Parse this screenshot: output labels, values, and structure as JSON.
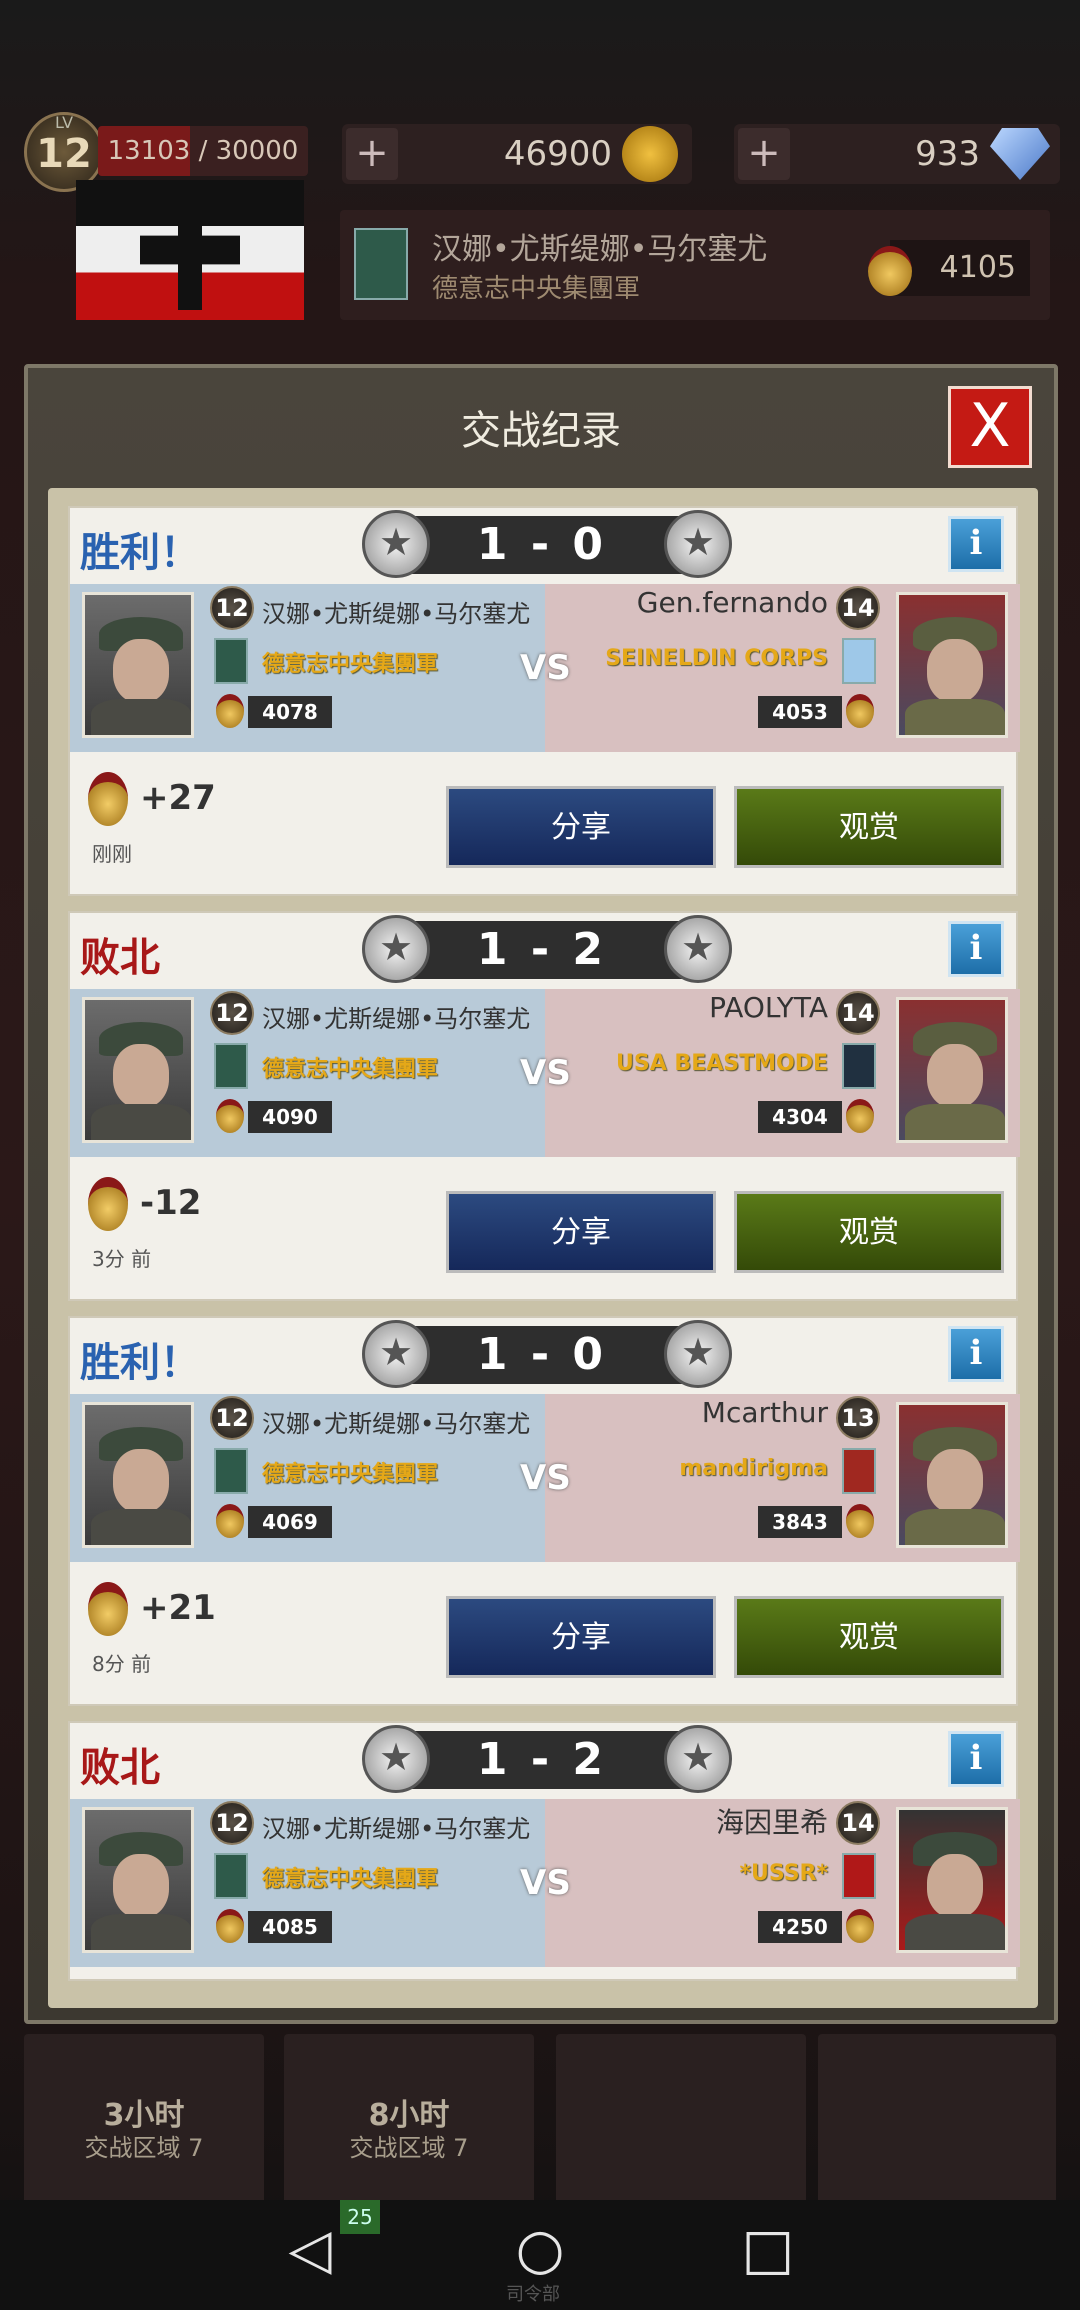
{
  "hud": {
    "level_label": "LV",
    "level": "12",
    "xp_text": "13103 / 30000",
    "xp_fraction": 0.437,
    "gold": "46900",
    "gems": "933",
    "plus": "+"
  },
  "alliance": {
    "commander": "汉娜•尤斯缇娜•马尔塞尤",
    "corps": "德意志中央集團軍",
    "points": "4105"
  },
  "dialog": {
    "title": "交战纪录",
    "close": "X"
  },
  "battles": [
    {
      "result": "胜利！",
      "score": "1 - 0",
      "left": {
        "level": "12",
        "name": "汉娜•尤斯缇娜•马尔塞尤",
        "corps": "德意志中央集團軍",
        "points": "4078"
      },
      "right": {
        "level": "14",
        "name": "Gen.fernando",
        "corps": "SEINELDIN CORPS",
        "points": "4053"
      },
      "vs": "VS",
      "delta": "+27",
      "time": "刚刚",
      "share": "分享",
      "watch": "观赏",
      "info": "i"
    },
    {
      "result": "败北",
      "score": "1 - 2",
      "left": {
        "level": "12",
        "name": "汉娜•尤斯缇娜•马尔塞尤",
        "corps": "德意志中央集團軍",
        "points": "4090"
      },
      "right": {
        "level": "14",
        "name": "PAOLYTA",
        "corps": "USA BEASTMODE",
        "points": "4304"
      },
      "vs": "VS",
      "delta": "-12",
      "time": "3分 前",
      "share": "分享",
      "watch": "观赏",
      "info": "i"
    },
    {
      "result": "胜利！",
      "score": "1 - 0",
      "left": {
        "level": "12",
        "name": "汉娜•尤斯缇娜•马尔塞尤",
        "corps": "德意志中央集團軍",
        "points": "4069"
      },
      "right": {
        "level": "13",
        "name": "Mcarthur",
        "corps": "mandirigma",
        "points": "3843"
      },
      "vs": "VS",
      "delta": "+21",
      "time": "8分 前",
      "share": "分享",
      "watch": "观赏",
      "info": "i"
    },
    {
      "result": "败北",
      "score": "1 - 2",
      "left": {
        "level": "12",
        "name": "汉娜•尤斯缇娜•马尔塞尤",
        "corps": "德意志中央集團軍",
        "points": "4085"
      },
      "right": {
        "level": "14",
        "name": "海因里希",
        "corps": "*USSR*",
        "points": "4250"
      },
      "vs": "VS",
      "info": "i"
    }
  ],
  "bottom": [
    {
      "title": "3小时",
      "subtitle": "交战区域 7"
    },
    {
      "title": "8小时",
      "subtitle": "交战区域 7"
    }
  ],
  "nav": {
    "badge": "25",
    "hq_label": "司令部"
  },
  "colors": {
    "win": "#2a62b0",
    "lose": "#a81818",
    "share_button": "#1f3a6e",
    "watch_button": "#4a6a10",
    "close_button": "#c41a14"
  }
}
